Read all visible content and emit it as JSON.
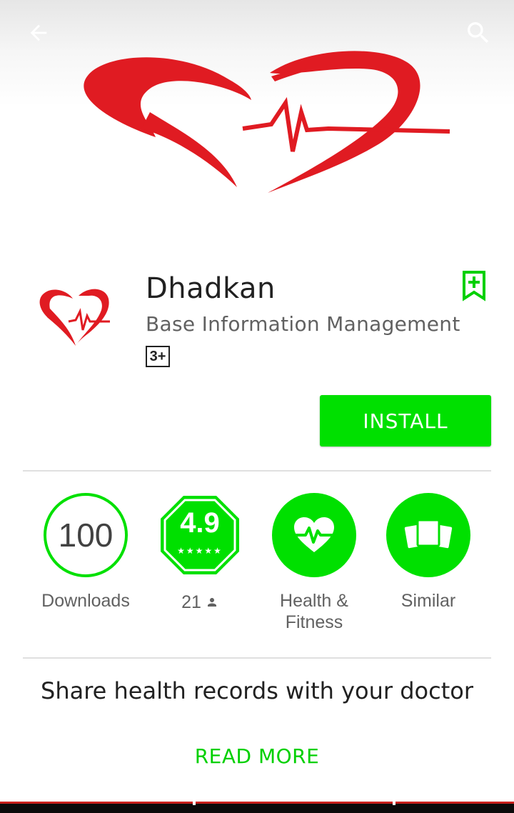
{
  "topbar": {
    "back_icon": "arrow-back-icon",
    "search_icon": "search-icon"
  },
  "feature_graphic": {
    "logo_icon": "heart-heartbeat-logo",
    "brand_color": "#e01b22"
  },
  "app": {
    "title": "Dhadkan",
    "developer": "Base Information Management",
    "content_rating": "3+",
    "wishlist_icon": "bookmark-add-icon",
    "install_label": "INSTALL",
    "accent_color": "#00e000"
  },
  "stats": {
    "downloads": {
      "value": "100",
      "label": "Downloads"
    },
    "rating": {
      "value": "4.9",
      "stars": 4.9,
      "count": "21",
      "count_icon": "person-icon"
    },
    "category": {
      "label": "Health & Fitness",
      "icon": "heart-pulse-icon"
    },
    "similar": {
      "label": "Similar",
      "icon": "cards-stack-icon"
    }
  },
  "description": {
    "tagline": "Share health records with your doctor",
    "read_more": "READ MORE"
  }
}
